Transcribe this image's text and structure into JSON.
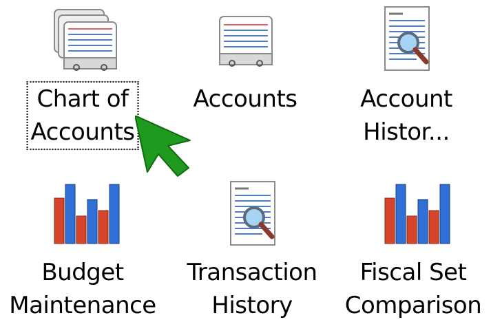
{
  "tiles": [
    {
      "id": "chart-of-accounts",
      "label": "Chart of\nAccounts",
      "icon": "card-stack-icon",
      "focused": true
    },
    {
      "id": "accounts",
      "label": "Accounts",
      "icon": "card-file-icon",
      "focused": false
    },
    {
      "id": "account-history",
      "label": "Account\nHistor...",
      "icon": "document-magnifier-icon",
      "focused": false
    },
    {
      "id": "budget-maintenance",
      "label": "Budget\nMaintenance",
      "icon": "bar-chart-icon",
      "focused": false
    },
    {
      "id": "transaction-history",
      "label": "Transaction\nHistory",
      "icon": "document-magnifier-icon",
      "focused": false
    },
    {
      "id": "fiscal-set-comparison",
      "label": "Fiscal Set\nComparison",
      "icon": "bar-chart-icon",
      "focused": false
    }
  ],
  "cursor": {
    "icon": "green-arrow-cursor-icon",
    "color": "#1f9a1f"
  },
  "colors": {
    "card_red_line": "#e06060",
    "card_blue_line": "#4c78d8",
    "bar_red": "#d4452c",
    "bar_blue": "#2f6fd6"
  }
}
